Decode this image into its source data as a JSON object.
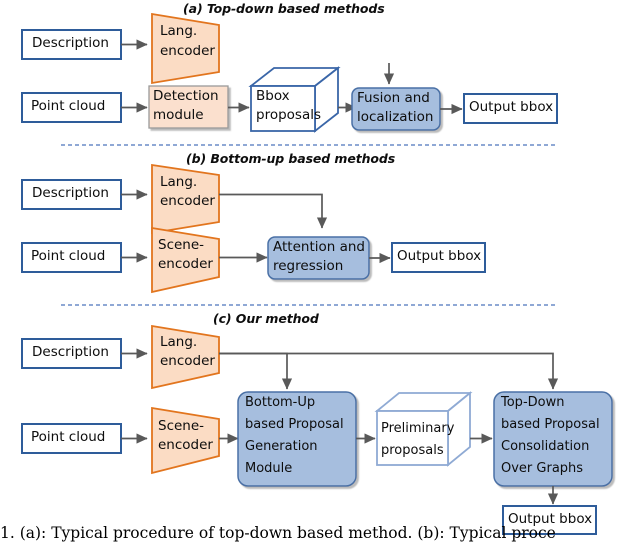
{
  "figure": {
    "caption": "1.  (a): Typical procedure of top-down based method.  (b): Typical proce"
  },
  "colors": {
    "trapezoid_fill": "#FBDCC4",
    "trapezoid_stroke": "#E2751E",
    "peach_box_fill": "#FBE0CE",
    "peach_box_stroke": "#9A9A9A",
    "blue_box_fill": "#A6BEDE",
    "blue_box_stroke": "#4A6FA5",
    "io_box_stroke": "#2E5C9A",
    "cube_stroke": "#3A66A8",
    "cube_stroke_light": "#8FAAD4",
    "arrow": "#595959",
    "divider": "#6A8CC7",
    "text": "#0D0D0D"
  },
  "sections": [
    {
      "id": "a",
      "title": "(a) Top-down based methods",
      "nodes": {
        "description": "Description",
        "lang_encoder_l1": "Lang.",
        "lang_encoder_l2": "encoder",
        "point_cloud": "Point cloud",
        "detection_l1": "Detection",
        "detection_l2": "module",
        "bbox_l1": "Bbox",
        "bbox_l2": "proposals",
        "fusion_l1": "Fusion and",
        "fusion_l2": "localization",
        "output": "Output bbox"
      }
    },
    {
      "id": "b",
      "title": "(b) Bottom-up based methods",
      "nodes": {
        "description": "Description",
        "lang_encoder_l1": "Lang.",
        "lang_encoder_l2": "encoder",
        "point_cloud": "Point cloud",
        "scene_l1": "Scene-",
        "scene_l2": "encoder",
        "attention_l1": "Attention and",
        "attention_l2": "regression",
        "output": "Output bbox"
      }
    },
    {
      "id": "c",
      "title": "(c) Our method",
      "nodes": {
        "description": "Description",
        "lang_encoder_l1": "Lang.",
        "lang_encoder_l2": "encoder",
        "point_cloud": "Point cloud",
        "scene_l1": "Scene-",
        "scene_l2": "encoder",
        "bupgm_l1": "Bottom-Up",
        "bupgm_l2": "based Proposal",
        "bupgm_l3": "Generation",
        "bupgm_l4": "Module",
        "prelim_l1": "Preliminary",
        "prelim_l2": "proposals",
        "tdpcog_l1": "Top-Down",
        "tdpcog_l2": "based Proposal",
        "tdpcog_l3": "Consolidation",
        "tdpcog_l4": "Over Graphs",
        "output": "Output bbox"
      }
    }
  ]
}
